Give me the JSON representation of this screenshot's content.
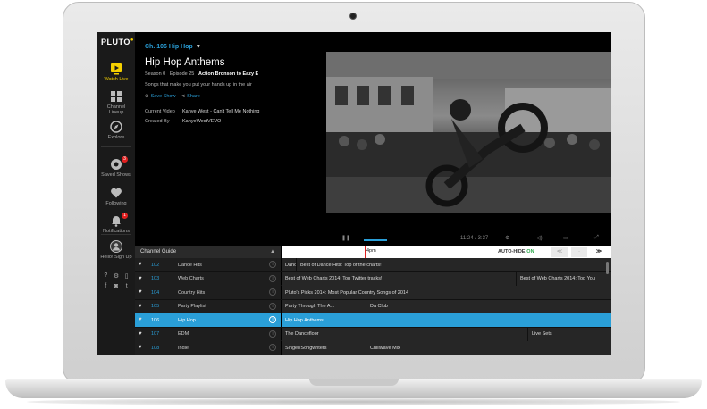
{
  "sidebar": {
    "logo": "PLUTO",
    "logo_mark": "tv",
    "items": [
      {
        "label": "Watch Live",
        "icon": "tv-play-icon"
      },
      {
        "label": "Channel\nLineup",
        "icon": "grid-icon"
      },
      {
        "label": "Explore",
        "icon": "compass-icon"
      },
      {
        "label": "Saved Shows",
        "icon": "record-icon",
        "badge": "3"
      },
      {
        "label": "Following",
        "icon": "heart-icon"
      },
      {
        "label": "Notifications",
        "icon": "bell-icon",
        "badge": "1"
      },
      {
        "label": "Hello! Sign Up",
        "icon": "avatar-icon"
      }
    ]
  },
  "now_playing": {
    "channel": "Ch. 106 Hip Hop",
    "show_title": "Hip Hop Anthems",
    "season": "Season 0",
    "episode": "Episode 25",
    "episode_title": "Action Bronson to Eazy E",
    "description": "Songs that make you put your hands up in the air",
    "save_label": "Save Show",
    "share_label": "Share",
    "current_video_label": "Current Video",
    "current_video": "Kanye West - Can't Tell Me Nothing",
    "created_by_label": "Created By",
    "created_by": "KanyeWestVEVO"
  },
  "player": {
    "time": "11:24 / 3:37"
  },
  "guide": {
    "title": "Channel Guide",
    "time_marker": "4pm",
    "autohide_label": "AUTO-HIDE:",
    "autohide_state": "ON",
    "rows": [
      {
        "num": "102",
        "name": "Dance Hits",
        "programs": [
          "Dance",
          "Best of Dance Hits: Top of the charts!"
        ]
      },
      {
        "num": "103",
        "name": "Web Charts",
        "programs": [
          "Best of Web Charts 2014: Top Twitter tracks!",
          "Best of Web Charts 2014: Top You"
        ]
      },
      {
        "num": "104",
        "name": "Country Hits",
        "programs": [
          "Pluto's Picks 2014: Most Popular Country Songs of 2014"
        ]
      },
      {
        "num": "105",
        "name": "Party Playlist",
        "programs": [
          "Party Through The A...",
          "Da Club"
        ]
      },
      {
        "num": "106",
        "name": "Hip Hop",
        "programs": [
          "Hip Hop Anthems"
        ],
        "selected": true
      },
      {
        "num": "107",
        "name": "EDM",
        "programs": [
          "The Dancefloor",
          "Live Sets"
        ]
      },
      {
        "num": "108",
        "name": "Indie",
        "programs": [
          "Singer/Songwriters",
          "Chillwave Mix"
        ]
      }
    ]
  }
}
